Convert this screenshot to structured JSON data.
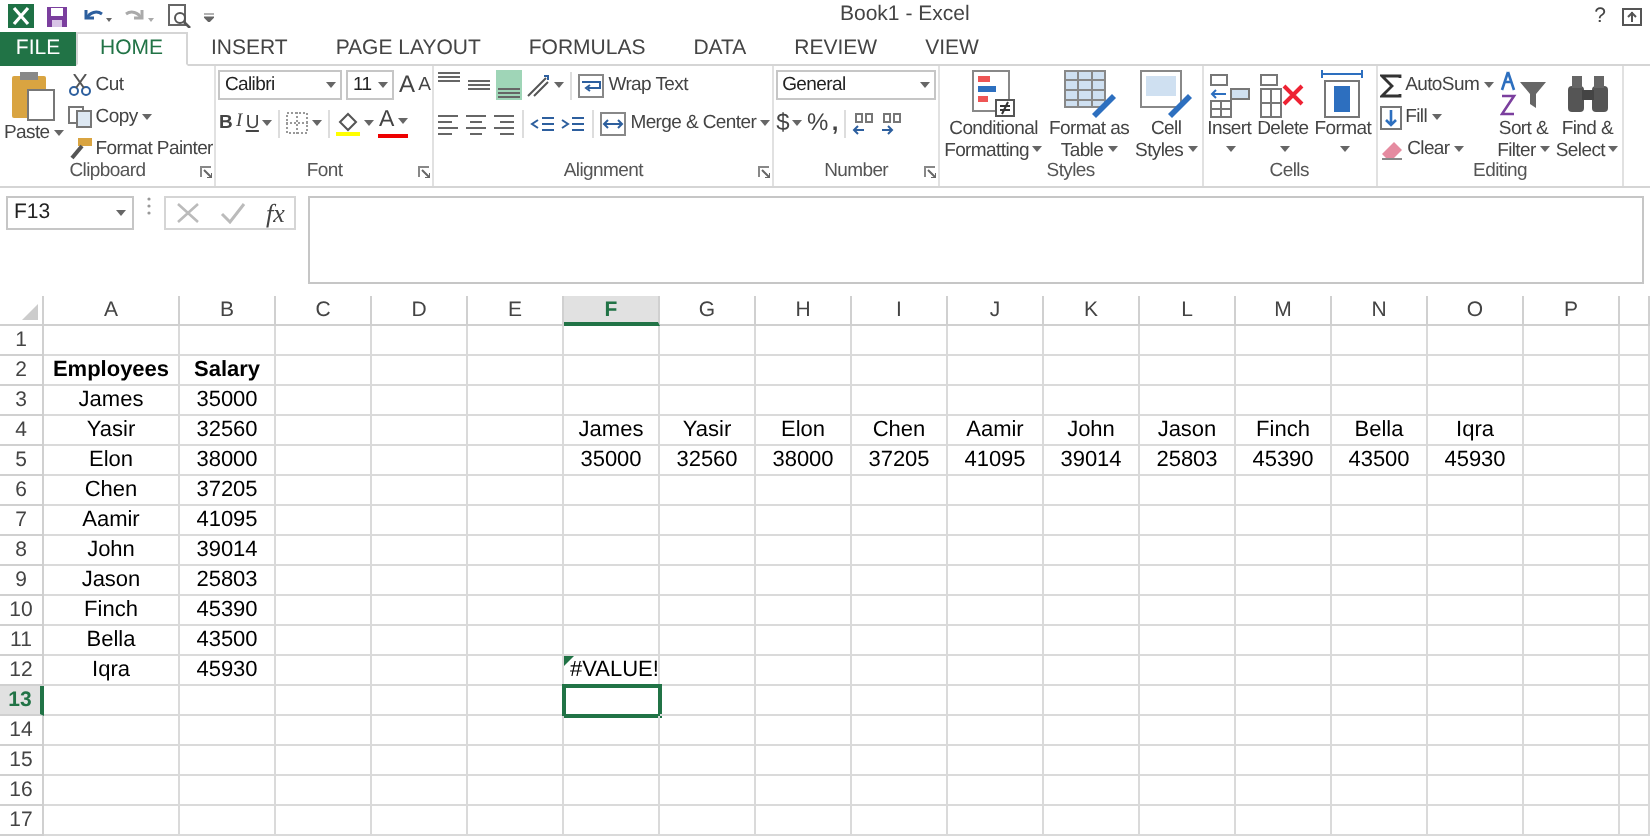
{
  "window": {
    "title": "Book1 - Excel",
    "help": "?"
  },
  "tabs": [
    {
      "label": "FILE",
      "kind": "file",
      "selected": false
    },
    {
      "label": "HOME",
      "kind": "tab",
      "selected": true
    },
    {
      "label": "INSERT",
      "kind": "tab",
      "selected": false
    },
    {
      "label": "PAGE LAYOUT",
      "kind": "tab",
      "selected": false
    },
    {
      "label": "FORMULAS",
      "kind": "tab",
      "selected": false
    },
    {
      "label": "DATA",
      "kind": "tab",
      "selected": false
    },
    {
      "label": "REVIEW",
      "kind": "tab",
      "selected": false
    },
    {
      "label": "VIEW",
      "kind": "tab",
      "selected": false
    }
  ],
  "ribbon": [
    {
      "kind": "clipboard",
      "label": "Clipboard",
      "launcher": true,
      "paste": "Paste",
      "items": [
        "Cut",
        "Copy",
        "Format Painter"
      ]
    },
    {
      "kind": "font",
      "label": "Font",
      "launcher": true,
      "font_name": "Calibri",
      "font_size": "11",
      "grow": "A",
      "shrink": "A",
      "bold": "B",
      "italic": "I",
      "underline": "U",
      "font_color": "A"
    },
    {
      "kind": "alignment",
      "label": "Alignment",
      "launcher": true,
      "vertical": [
        {
          "kind": "top",
          "selected": false
        },
        {
          "kind": "middle",
          "selected": false
        },
        {
          "kind": "bottom",
          "selected": true
        }
      ],
      "wrap_text": "Wrap Text",
      "merge": "Merge & Center"
    },
    {
      "kind": "number",
      "label": "Number",
      "launcher": true,
      "format": "General",
      "currency": "$",
      "percent": "%",
      "comma": ","
    },
    {
      "kind": "styles",
      "label": "Styles",
      "buttons": [
        {
          "lines": [
            "Conditional",
            "Formatting"
          ]
        },
        {
          "lines": [
            "Format as",
            "Table"
          ]
        },
        {
          "lines": [
            "Cell",
            "Styles"
          ]
        }
      ]
    },
    {
      "kind": "cells",
      "label": "Cells",
      "buttons": [
        "Insert",
        "Delete",
        "Format"
      ]
    },
    {
      "kind": "editing",
      "label": "Editing",
      "items": [
        "AutoSum",
        "Fill",
        "Clear"
      ],
      "buttons": [
        {
          "lines": [
            "Sort &",
            "Filter"
          ]
        },
        {
          "lines": [
            "Find &",
            "Select"
          ]
        }
      ]
    }
  ],
  "formula_bar": {
    "name_box": "F13",
    "function_label": "fx"
  },
  "columns": [
    {
      "label": "A",
      "selected": false
    },
    {
      "label": "B",
      "selected": false
    },
    {
      "label": "C",
      "selected": false
    },
    {
      "label": "D",
      "selected": false
    },
    {
      "label": "E",
      "selected": false
    },
    {
      "label": "F",
      "selected": true
    },
    {
      "label": "G",
      "selected": false
    },
    {
      "label": "H",
      "selected": false
    },
    {
      "label": "I",
      "selected": false
    },
    {
      "label": "J",
      "selected": false
    },
    {
      "label": "K",
      "selected": false
    },
    {
      "label": "L",
      "selected": false
    },
    {
      "label": "M",
      "selected": false
    },
    {
      "label": "N",
      "selected": false
    },
    {
      "label": "O",
      "selected": false
    },
    {
      "label": "P",
      "selected": false
    }
  ],
  "rows": [
    {
      "label": "1",
      "selected": false
    },
    {
      "label": "2",
      "selected": false,
      "cells": [
        {
          "text": "Employees",
          "bold": true
        },
        {
          "text": "Salary",
          "bold": true
        }
      ]
    },
    {
      "label": "3",
      "selected": false,
      "cells": [
        {
          "text": "James"
        },
        {
          "text": "35000"
        }
      ]
    },
    {
      "label": "4",
      "selected": false,
      "cells": [
        {
          "text": "Yasir"
        },
        {
          "text": "32560"
        },
        null,
        null,
        null,
        {
          "text": "James"
        },
        {
          "text": "Yasir"
        },
        {
          "text": "Elon"
        },
        {
          "text": "Chen"
        },
        {
          "text": "Aamir"
        },
        {
          "text": "John"
        },
        {
          "text": "Jason"
        },
        {
          "text": "Finch"
        },
        {
          "text": "Bella"
        },
        {
          "text": "Iqra"
        }
      ]
    },
    {
      "label": "5",
      "selected": false,
      "cells": [
        {
          "text": "Elon"
        },
        {
          "text": "38000"
        },
        null,
        null,
        null,
        {
          "text": "35000"
        },
        {
          "text": "32560"
        },
        {
          "text": "38000"
        },
        {
          "text": "37205"
        },
        {
          "text": "41095"
        },
        {
          "text": "39014"
        },
        {
          "text": "25803"
        },
        {
          "text": "45390"
        },
        {
          "text": "43500"
        },
        {
          "text": "45930"
        }
      ]
    },
    {
      "label": "6",
      "selected": false,
      "cells": [
        {
          "text": "Chen"
        },
        {
          "text": "37205"
        }
      ]
    },
    {
      "label": "7",
      "selected": false,
      "cells": [
        {
          "text": "Aamir"
        },
        {
          "text": "41095"
        }
      ]
    },
    {
      "label": "8",
      "selected": false,
      "cells": [
        {
          "text": "John"
        },
        {
          "text": "39014"
        }
      ]
    },
    {
      "label": "9",
      "selected": false,
      "cells": [
        {
          "text": "Jason"
        },
        {
          "text": "25803"
        }
      ]
    },
    {
      "label": "10",
      "selected": false,
      "cells": [
        {
          "text": "Finch"
        },
        {
          "text": "45390"
        }
      ]
    },
    {
      "label": "11",
      "selected": false,
      "cells": [
        {
          "text": "Bella"
        },
        {
          "text": "43500"
        }
      ]
    },
    {
      "label": "12",
      "selected": false,
      "cells": [
        {
          "text": "Iqra"
        },
        {
          "text": "45930"
        },
        null,
        null,
        null,
        {
          "text": "#VALUE!",
          "error": true
        }
      ]
    },
    {
      "label": "13",
      "selected": true,
      "cells": [
        null,
        null,
        null,
        null,
        null,
        {
          "active": true
        }
      ]
    },
    {
      "label": "14",
      "selected": false
    },
    {
      "label": "15",
      "selected": false
    },
    {
      "label": "16",
      "selected": false
    },
    {
      "label": "17",
      "selected": false
    }
  ]
}
